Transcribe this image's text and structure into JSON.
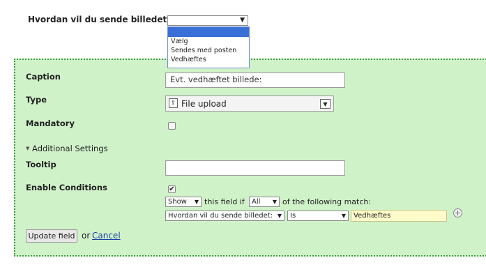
{
  "question": {
    "label": "Hvordan vil du sende billedet:",
    "selected": "",
    "options": [
      "",
      "Vælg",
      "Sendes med posten",
      "Vedhæftes"
    ]
  },
  "form": {
    "caption_label": "Caption",
    "caption_value": "Evt. vedhæftet billede:",
    "type_label": "Type",
    "type_value": "File upload",
    "mandatory_label": "Mandatory",
    "mandatory_checked": false,
    "additional_settings": "Additional Settings",
    "tooltip_label": "Tooltip",
    "tooltip_value": "",
    "enable_conditions_label": "Enable Conditions",
    "enable_conditions_checked": true,
    "condition": {
      "action": "Show",
      "text1": "this field if",
      "match": "All",
      "text2": "of the following match:",
      "field": "Hvordan vil du sende billedet:",
      "operator": "Is",
      "value": "Vedhæftes"
    }
  },
  "buttons": {
    "update": "Update field",
    "or": "or",
    "cancel": "Cancel"
  },
  "colors": {
    "panel_bg": "#d0f2c9",
    "panel_border": "#3a9a3a",
    "highlight": "#fdfbc9",
    "selected_option": "#3a6fd8",
    "link": "#1a3fa8"
  }
}
